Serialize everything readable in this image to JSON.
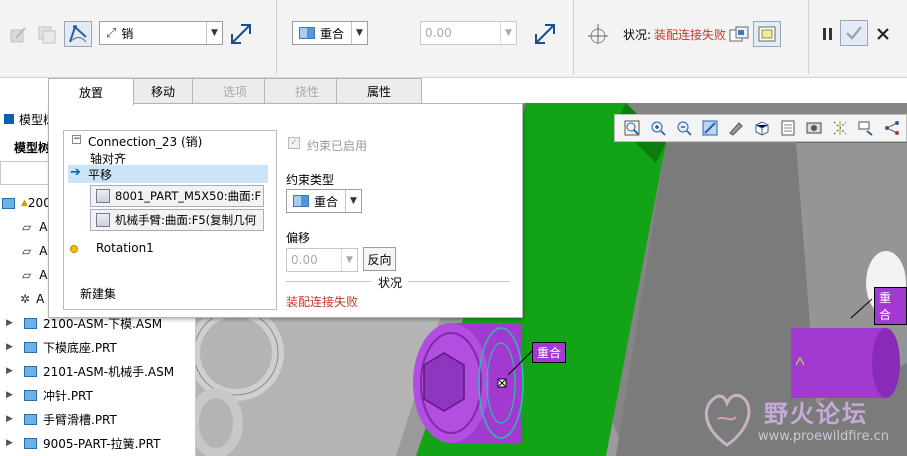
{
  "ribbon": {
    "connection_type": "销",
    "constraint_type": "重合",
    "offset_value": "0.00",
    "status_label": "状况:",
    "status_value": "装配连接失败"
  },
  "tabs": [
    {
      "label": "放置",
      "state": "active"
    },
    {
      "label": "移动",
      "state": "normal"
    },
    {
      "label": "选项",
      "state": "disabled"
    },
    {
      "label": "挠性",
      "state": "disabled"
    },
    {
      "label": "属性",
      "state": "normal"
    }
  ],
  "panel": {
    "connection_title": "Connection_23 (销)",
    "axis_align": "轴对齐",
    "translate": "平移",
    "ref1": "8001_PART_M5X50:曲面:F",
    "ref2": "机械手臂:曲面:F5(复制几何",
    "rotation": "Rotation1",
    "new_set": "新建集",
    "constraint_enabled": "约束已启用",
    "constraint_type_label": "约束类型",
    "constraint_type_value": "重合",
    "offset_label": "偏移",
    "offset_value": "0.00",
    "flip_button": "反向",
    "status_header": "状况",
    "status_value": "装配连接失败"
  },
  "tree": {
    "label_partial": "模型树",
    "header_partial": "模型树",
    "items": [
      {
        "prefix": "",
        "text": "200",
        "kind": "assembly"
      },
      {
        "prefix": "",
        "text": "A",
        "kind": "datum-plane"
      },
      {
        "prefix": "",
        "text": "A",
        "kind": "datum-plane"
      },
      {
        "prefix": "",
        "text": "A",
        "kind": "datum-plane"
      },
      {
        "prefix": "",
        "text": "A",
        "kind": "csys"
      },
      {
        "prefix": "",
        "text": "2100-ASM-下模.ASM",
        "kind": "assembly"
      },
      {
        "prefix": "",
        "text": "下模底座.PRT",
        "kind": "part"
      },
      {
        "prefix": "",
        "text": "2101-ASM-机械手.ASM",
        "kind": "assembly"
      },
      {
        "prefix": "",
        "text": "冲针.PRT",
        "kind": "part"
      },
      {
        "prefix": "",
        "text": "手臂滑槽.PRT",
        "kind": "part"
      },
      {
        "prefix": "",
        "text": "9005-PART-拉簧.PRT",
        "kind": "part"
      }
    ]
  },
  "viewport": {
    "tag1": "重合",
    "tag2": "重合"
  },
  "watermark": {
    "title": "野火论坛",
    "url": "www.proewildfire.cn"
  },
  "colors": {
    "accent_blue": "#0b5fb0",
    "status_red": "#c0392b",
    "green_surface": "#13a316",
    "purple_part": "#a23ad2",
    "gray_body": "#8c8c8c"
  }
}
